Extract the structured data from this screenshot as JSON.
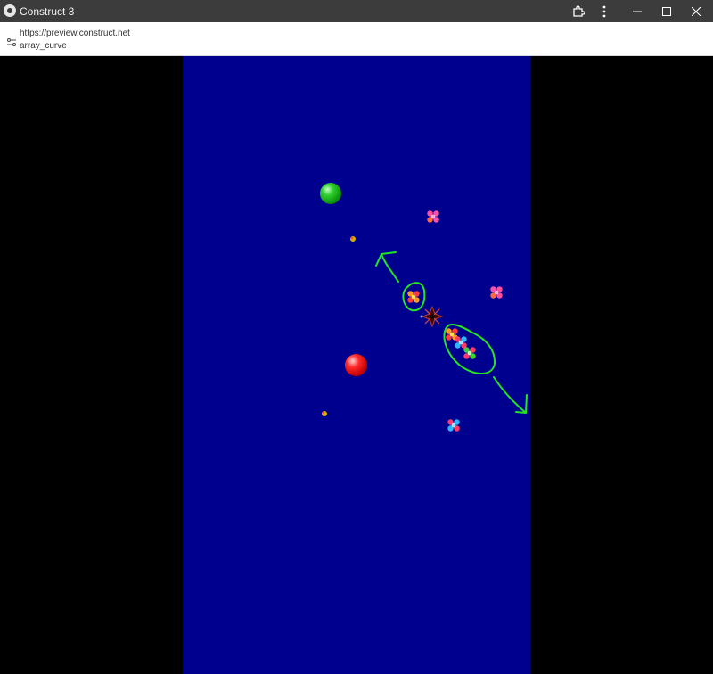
{
  "window": {
    "title": "Construct 3",
    "icons": {
      "app": "construct-logo-icon",
      "extensions": "puzzle-icon",
      "more": "more-vert-icon",
      "minimize": "minimize-icon",
      "maximize": "maximize-icon",
      "close": "close-icon"
    }
  },
  "address_bar": {
    "url": "https://preview.construct.net",
    "page": "array_curve",
    "site_icon": "site-settings-icon"
  },
  "game": {
    "background_color": "#00008f",
    "objects": [
      "green-ball",
      "red-ball",
      "player-ship",
      "enemy-ships"
    ],
    "annotation_color": "#22e622"
  }
}
